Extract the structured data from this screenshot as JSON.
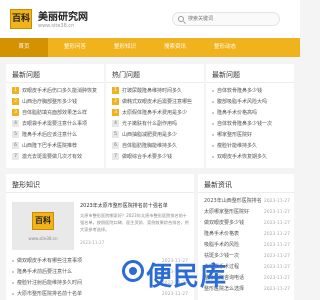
{
  "header": {
    "logo_text": "百科",
    "site_name": "美丽研究网",
    "site_url": "www.site38.cn",
    "search_placeholder": "搜索关键词"
  },
  "nav": {
    "items": [
      "首页",
      "整形问答",
      "整形知识",
      "搜索资讯",
      "整形动态"
    ]
  },
  "latest_questions": {
    "title": "最新问题",
    "items": [
      {
        "num": "1",
        "text": "双眼皮手术后伤口多久能消肿恢复"
      },
      {
        "num": "2",
        "text": "山西治疗胸部整形多少钱"
      },
      {
        "num": "3",
        "text": "自体脂肪填充面部效果怎么样"
      },
      {
        "num": "4",
        "text": "去眼袋手术需要注意什么事项"
      },
      {
        "num": "5",
        "text": "隆鼻手术后应该注意什么"
      },
      {
        "num": "6",
        "text": "山西隆下巴手术医院推荐"
      },
      {
        "num": "7",
        "text": "激光去斑需要做几次才有效"
      },
      {
        "num": "8",
        "text": "哪家整形医院比较靠谱"
      }
    ]
  },
  "hot_questions": {
    "title": "热门问题",
    "items": [
      {
        "num": "1",
        "text": "打玻尿酸隆鼻维持时间多久"
      },
      {
        "num": "2",
        "text": "做韩式双眼皮术后需要注意哪些"
      },
      {
        "num": "3",
        "text": "太原假体隆鼻手术费用是多少"
      },
      {
        "num": "4",
        "text": "光子嫩肤有什么副作用吗"
      },
      {
        "num": "5",
        "text": "山西抽脂减肥费用是多少"
      },
      {
        "num": "6",
        "text": "自体脂肪隆胸能维持多久"
      },
      {
        "num": "7",
        "text": "做眼综合手术要多少钱"
      }
    ]
  },
  "recent_updates": {
    "title": "最新问题",
    "items": [
      "自体软骨隆鼻多少钱",
      "腹部吸脂手术风险大吗",
      "隆鼻手术价格高吗",
      "自体软骨隆鼻多少钱一次",
      "哪家整形医院好",
      "瘦脸针能维持多久",
      "双眼皮手术恢复期多久"
    ]
  },
  "knowledge": {
    "title": "整形知识",
    "thumb_logo": "百科",
    "thumb_url": "www.site38.cn",
    "feature_title": "2023年太原市整形医院排名前十强名单",
    "feature_text": "太原市整形医院哪家好？2023年太原市整形医院排名前十强名单，按照医院口碑、医生资质、案例效果综合排名，供大家参考选择。",
    "feature_date": "2023-11-27",
    "items": [
      {
        "text": "做双眼皮手术有哪些注意事项",
        "date": "2023-11-27"
      },
      {
        "text": "隆鼻手术前后要注意什么",
        "date": "2023-11-27"
      },
      {
        "text": "瘦脸针注射后能维持多久时间",
        "date": "2023-11-27"
      },
      {
        "text": "大原市整形医院排名前十名单",
        "date": "2023-11-27"
      },
      {
        "text": "割双眼皮之后多久能化妆",
        "date": "2023-11-27"
      }
    ]
  },
  "latest_news": {
    "title": "最新资讯",
    "items": [
      {
        "text": "2023年山西整形医院排名",
        "date": "2023-11-27"
      },
      {
        "text": "太原哪家整形医院好",
        "date": "2023-11-27"
      },
      {
        "text": "做双眼皮要多少钱",
        "date": "2023-11-27"
      },
      {
        "text": "隆鼻手术价格表",
        "date": "2023-11-27"
      },
      {
        "text": "吸脂手术的风险",
        "date": "2023-11-27"
      },
      {
        "text": "祛斑多少钱一次",
        "date": "2023-11-27"
      },
      {
        "text": "去眼袋手术过程",
        "date": "2023-11-27"
      },
      {
        "text": "整形医院咨询电话",
        "date": "2023-11-27"
      },
      {
        "text": "整形医院怎么选择",
        "date": "2023-11-27"
      },
      {
        "text": "太原整形医院推荐",
        "date": "2023-11-27"
      }
    ]
  },
  "watermark_text": "便民库",
  "colors": {
    "accent": "#f0b21d",
    "accent_dark": "#d39200",
    "watermark": "#2b6bd6"
  }
}
